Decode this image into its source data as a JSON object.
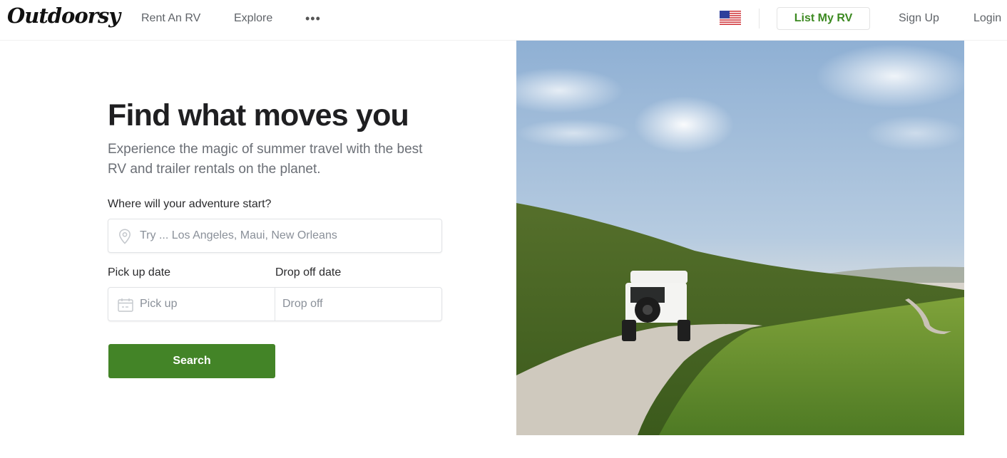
{
  "header": {
    "logo": "Outdoorsy",
    "nav": {
      "rent": "Rent An RV",
      "explore": "Explore",
      "more": "•••"
    },
    "locale_flag": "us-flag-icon",
    "list_my_rv": "List My RV",
    "sign_up": "Sign Up",
    "login": "Login"
  },
  "hero": {
    "title": "Find what moves you",
    "subtitle": "Experience the magic of summer travel with the best RV and trailer rentals on the planet.",
    "location": {
      "label": "Where will your adventure start?",
      "placeholder": "Try ... Los Angeles, Maui, New Orleans",
      "value": ""
    },
    "pickup": {
      "label": "Pick up date",
      "placeholder": "Pick up",
      "value": ""
    },
    "dropoff": {
      "label": "Drop off date",
      "placeholder": "Drop off",
      "value": ""
    },
    "search_button": "Search",
    "image_alt": "White SUV with rooftop tent driving on a dirt road along green hills near a bay"
  },
  "colors": {
    "brand_green": "#438427",
    "link_green": "#3d8a22",
    "text_dark": "#1f1f21",
    "text_muted": "#6b6f76"
  }
}
